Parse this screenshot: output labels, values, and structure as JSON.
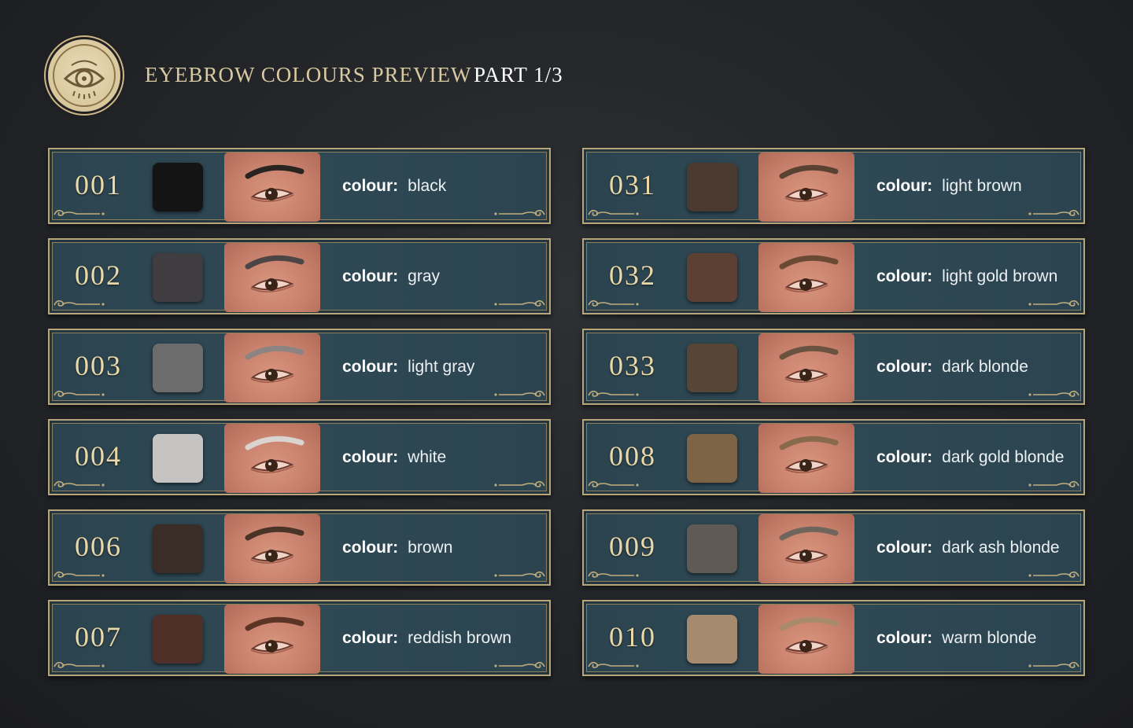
{
  "header": {
    "title": "EYEBROW COLOURS PREVIEW",
    "part": "PART 1/3",
    "emblem_icon": "eye-emblem-icon"
  },
  "label_key": "colour:",
  "colors": {
    "accent_gold": "#d8c9a0",
    "card_bg": "#2d4651",
    "border": "#b9a57a"
  },
  "items": [
    {
      "code": "001",
      "colour": "black",
      "swatch": "#141414",
      "brow": "#2a2420"
    },
    {
      "code": "002",
      "colour": "gray",
      "swatch": "#3f3d3f",
      "brow": "#4b4546"
    },
    {
      "code": "003",
      "colour": "light gray",
      "swatch": "#6d6c6c",
      "brow": "#8b8482"
    },
    {
      "code": "004",
      "colour": "white",
      "swatch": "#c6c4c3",
      "brow": "#d9d4d0"
    },
    {
      "code": "006",
      "colour": "brown",
      "swatch": "#3a2c26",
      "brow": "#4a3428"
    },
    {
      "code": "007",
      "colour": "reddish brown",
      "swatch": "#4f2f28",
      "brow": "#5b3426"
    },
    {
      "code": "031",
      "colour": "light brown",
      "swatch": "#4b3a30",
      "brow": "#5a4233"
    },
    {
      "code": "032",
      "colour": "light gold brown",
      "swatch": "#5c4033",
      "brow": "#6b4a35"
    },
    {
      "code": "033",
      "colour": "dark blonde",
      "swatch": "#574538",
      "brow": "#6a5240"
    },
    {
      "code": "008",
      "colour": "dark gold blonde",
      "swatch": "#7e6447",
      "brow": "#876a4b"
    },
    {
      "code": "009",
      "colour": "dark ash blonde",
      "swatch": "#605a55",
      "brow": "#6e655d"
    },
    {
      "code": "010",
      "colour": "warm blonde",
      "swatch": "#a68a70",
      "brow": "#a88b6b"
    }
  ]
}
